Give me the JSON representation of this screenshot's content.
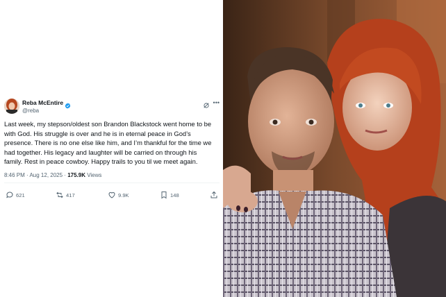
{
  "tweet": {
    "author": {
      "display_name": "Reba McEntire",
      "handle": "@reba",
      "verified": true
    },
    "text": "Last week, my stepson/oldest son Brandon Blackstock went home to be\nwith God. His struggle is over and he is in eternal peace in God’s\npresence. There is no one else like him, and I’m thankful for the time we\nhad together. His legacy and laughter will be carried on through his\nfamily. Rest in peace cowboy. Happy trails to you til we meet again.",
    "meta": {
      "time": "8:46 PM",
      "separator": " · ",
      "date": "Aug 12, 2025",
      "views_count": "175.9K",
      "views_label": " Views"
    },
    "actions": {
      "replies": "621",
      "reposts": "417",
      "likes": "9.9K",
      "bookmarks": "148"
    },
    "icons": [
      "verified-badge-icon",
      "grok-icon",
      "more-icon",
      "reply-icon",
      "repost-icon",
      "like-icon",
      "bookmark-icon",
      "share-icon"
    ]
  },
  "colors": {
    "text_primary": "#0f1419",
    "text_secondary": "#536471",
    "verified_blue": "#1d9bf0",
    "divider": "#eff3f4"
  }
}
